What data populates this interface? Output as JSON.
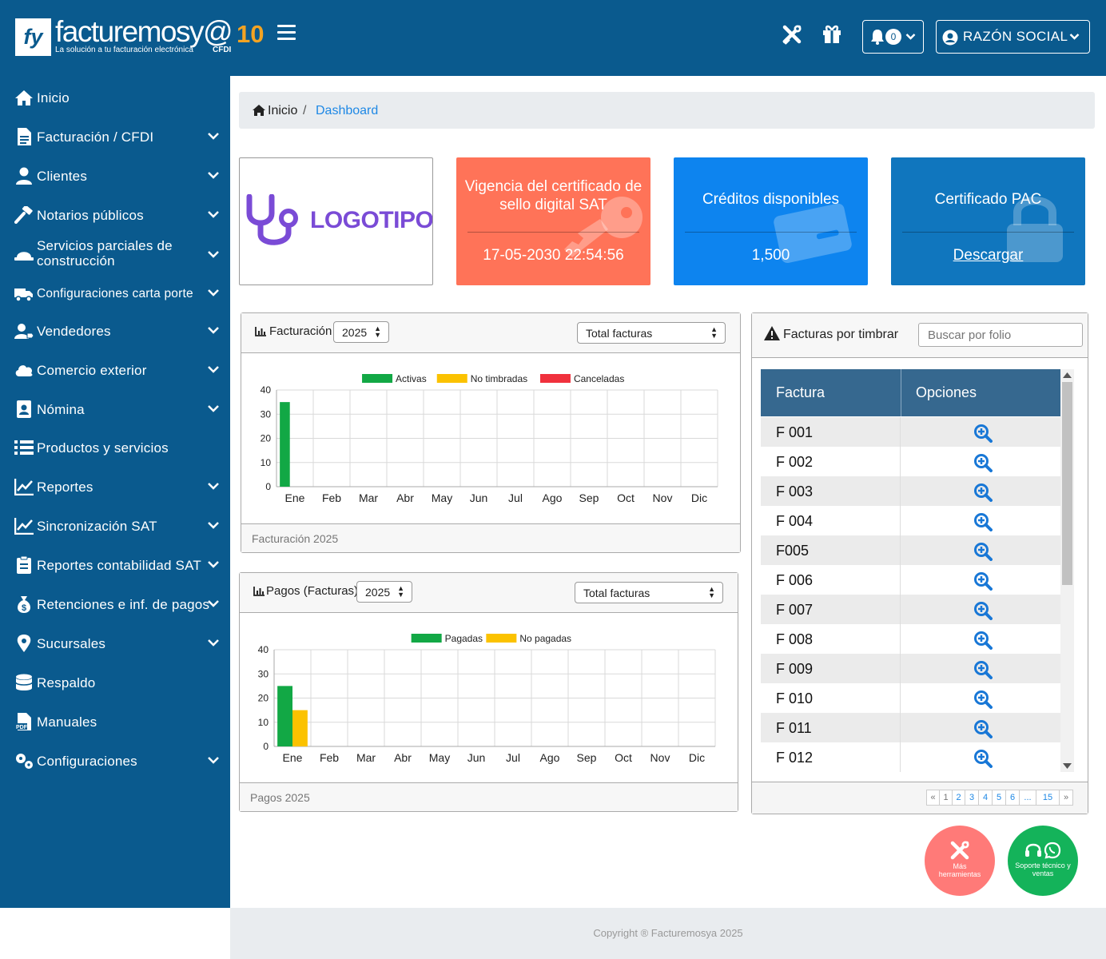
{
  "brand": {
    "name": "facturemosy@",
    "ten": "10",
    "tagline": "La solución a tu facturación electrónica",
    "cfdi": "CFDI",
    "mark": "fy"
  },
  "header": {
    "notifications_count": "0",
    "account_label": "RAZÓN SOCIAL"
  },
  "sidebar": {
    "items": [
      {
        "label": "Inicio",
        "icon": "home-icon",
        "expandable": false
      },
      {
        "label": "Facturación / CFDI",
        "icon": "document-icon",
        "expandable": true
      },
      {
        "label": "Clientes",
        "icon": "user-icon",
        "expandable": true
      },
      {
        "label": "Notarios públicos",
        "icon": "gavel-icon",
        "expandable": true
      },
      {
        "label": "Servicios parciales de construcción",
        "icon": "helmet-icon",
        "expandable": true
      },
      {
        "label": "Configuraciones carta porte",
        "icon": "truck-icon",
        "expandable": true
      },
      {
        "label": "Vendedores",
        "icon": "user-tag-icon",
        "expandable": true
      },
      {
        "label": "Comercio exterior",
        "icon": "cloud-icon",
        "expandable": true
      },
      {
        "label": "Nómina",
        "icon": "id-badge-icon",
        "expandable": true
      },
      {
        "label": "Productos y servicios",
        "icon": "list-icon",
        "expandable": false
      },
      {
        "label": "Reportes",
        "icon": "line-chart-icon",
        "expandable": true
      },
      {
        "label": "Sincronización SAT",
        "icon": "line-chart-icon",
        "expandable": true
      },
      {
        "label": "Reportes contabilidad SAT",
        "icon": "clipboard-icon",
        "expandable": true
      },
      {
        "label": "Retenciones e inf. de pagos",
        "icon": "money-bag-icon",
        "expandable": true
      },
      {
        "label": "Sucursales",
        "icon": "map-marker-icon",
        "expandable": true
      },
      {
        "label": "Respaldo",
        "icon": "database-icon",
        "expandable": false
      },
      {
        "label": "Manuales",
        "icon": "pdf-file-icon",
        "expandable": false
      },
      {
        "label": "Configuraciones",
        "icon": "cogs-icon",
        "expandable": true
      }
    ]
  },
  "breadcrumb": {
    "home": "Inicio",
    "separator": "/",
    "current": "Dashboard"
  },
  "cards": {
    "logo": {
      "text": "LOGOTIPO"
    },
    "certificado_sello": {
      "title": "Vigencia del certificado de sello digital SAT",
      "value": "17-05-2030 22:54:56",
      "color": "#ff7358",
      "icon": "key-icon"
    },
    "creditos": {
      "title": "Créditos disponibles",
      "value": "1,500",
      "color": "#0d84ef",
      "icon": "credit-card-icon"
    },
    "pac": {
      "title": "Certificado PAC",
      "link": "Descargar",
      "color": "#1076be",
      "icon": "lock-icon"
    }
  },
  "facturacion_panel": {
    "title": "Facturación",
    "year": "2025",
    "metric": "Total facturas",
    "footer": "Facturación 2025"
  },
  "pagos_panel": {
    "title": "Pagos (Facturas)",
    "year": "2025",
    "metric": "Total facturas",
    "footer": "Pagos 2025"
  },
  "chart_data": [
    {
      "type": "bar",
      "categories": [
        "Ene",
        "Feb",
        "Mar",
        "Abr",
        "May",
        "Jun",
        "Jul",
        "Ago",
        "Sep",
        "Oct",
        "Nov",
        "Dic"
      ],
      "series": [
        {
          "name": "Activas",
          "color": "#12a845",
          "values": [
            35,
            0,
            0,
            0,
            0,
            0,
            0,
            0,
            0,
            0,
            0,
            0
          ]
        },
        {
          "name": "No timbradas",
          "color": "#fbc200",
          "values": [
            0,
            0,
            0,
            0,
            0,
            0,
            0,
            0,
            0,
            0,
            0,
            0
          ]
        },
        {
          "name": "Canceladas",
          "color": "#f0313d",
          "values": [
            0,
            0,
            0,
            0,
            0,
            0,
            0,
            0,
            0,
            0,
            0,
            0
          ]
        }
      ],
      "yticks": [
        0,
        10,
        20,
        30,
        40
      ],
      "ylim": [
        0,
        40
      ],
      "grid": true,
      "legend": "top"
    },
    {
      "type": "bar",
      "categories": [
        "Ene",
        "Feb",
        "Mar",
        "Abr",
        "May",
        "Jun",
        "Jul",
        "Ago",
        "Sep",
        "Oct",
        "Nov",
        "Dic"
      ],
      "series": [
        {
          "name": "Pagadas",
          "color": "#12a845",
          "values": [
            25,
            0,
            0,
            0,
            0,
            0,
            0,
            0,
            0,
            0,
            0,
            0
          ]
        },
        {
          "name": "No pagadas",
          "color": "#fbc200",
          "values": [
            15,
            0,
            0,
            0,
            0,
            0,
            0,
            0,
            0,
            0,
            0,
            0
          ]
        }
      ],
      "yticks": [
        0,
        10,
        20,
        30,
        40
      ],
      "ylim": [
        0,
        40
      ],
      "grid": true,
      "legend": "top"
    }
  ],
  "pendientes": {
    "title": "Facturas por timbrar",
    "search_placeholder": "Buscar por folio",
    "columns": [
      "Factura",
      "Opciones"
    ],
    "rows": [
      "F 001",
      "F 002",
      "F 003",
      "F 004",
      "F005",
      "F 006",
      "F 007",
      "F 008",
      "F 009",
      "F 010",
      "F 011",
      "F 012"
    ],
    "pagination": {
      "prev": "«",
      "pages": [
        "1",
        "2",
        "3",
        "4",
        "5",
        "6",
        "...",
        "15"
      ],
      "next": "»"
    }
  },
  "fabs": {
    "tools": "Más herramientas",
    "support": "Soporte técnico y ventas"
  },
  "footer": {
    "copyright": "Copyright ® Facturemosya 2025"
  }
}
